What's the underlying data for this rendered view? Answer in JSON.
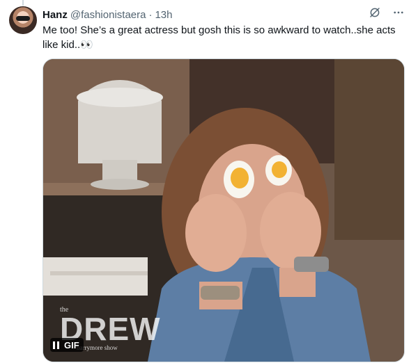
{
  "tweet": {
    "author_name": "Hanz",
    "handle": "@fashionistaera",
    "separator": "·",
    "time": "13h",
    "text": "Me too! She’s a great actress but gosh this is so awkward to watch..she acts like kid..👀"
  },
  "actions": {
    "grok_icon": "slash-circle-icon",
    "more_icon": "more-icon"
  },
  "media": {
    "show_logo_small": "the",
    "show_logo_big": "DREW",
    "show_logo_sub": "barrymore show",
    "gif_label": "GIF"
  },
  "colors": {
    "text": "#0f1419",
    "secondary": "#536471",
    "border": "#cfd9de"
  }
}
